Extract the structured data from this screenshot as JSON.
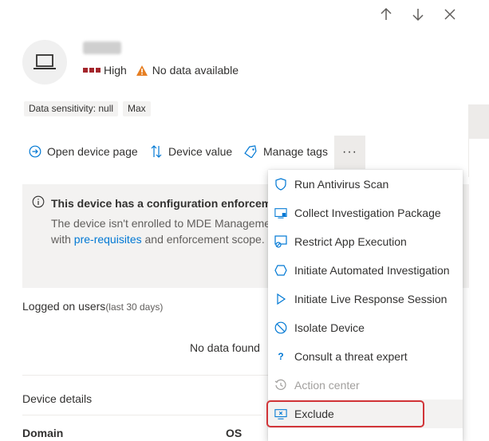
{
  "device": {
    "severity_label": "High",
    "data_status": "No data available",
    "colors": {
      "severity": "#a4262c",
      "warning": "#e67e22",
      "accent": "#0078d4"
    }
  },
  "tags": [
    "Data sensitivity: null",
    "Max"
  ],
  "actions": {
    "open_device_page": "Open device page",
    "device_value": "Device value",
    "manage_tags": "Manage tags",
    "more": "···"
  },
  "banner": {
    "title": "This device has a configuration enforcemen",
    "line1": "The device isn't enrolled to MDE Manageme",
    "line2_prefix": "with ",
    "line2_link": "pre-requisites",
    "line2_suffix": " and enforcement scope."
  },
  "logged_on": {
    "label": "Logged on users",
    "sub": "(last 30 days)",
    "empty": "No data found"
  },
  "device_details": {
    "title": "Device details",
    "col1": "Domain",
    "col2": "OS"
  },
  "menu": {
    "items": [
      {
        "label": "Run Antivirus Scan",
        "icon": "shield-icon"
      },
      {
        "label": "Collect Investigation Package",
        "icon": "package-icon"
      },
      {
        "label": "Restrict App Execution",
        "icon": "restrict-app-icon"
      },
      {
        "label": "Initiate Automated Investigation",
        "icon": "hexagon-icon"
      },
      {
        "label": "Initiate Live Response Session",
        "icon": "play-icon"
      },
      {
        "label": "Isolate Device",
        "icon": "block-icon"
      },
      {
        "label": "Consult a threat expert",
        "icon": "question-icon"
      },
      {
        "label": "Action center",
        "icon": "history-icon"
      },
      {
        "label": "Exclude",
        "icon": "exclude-icon"
      }
    ]
  }
}
